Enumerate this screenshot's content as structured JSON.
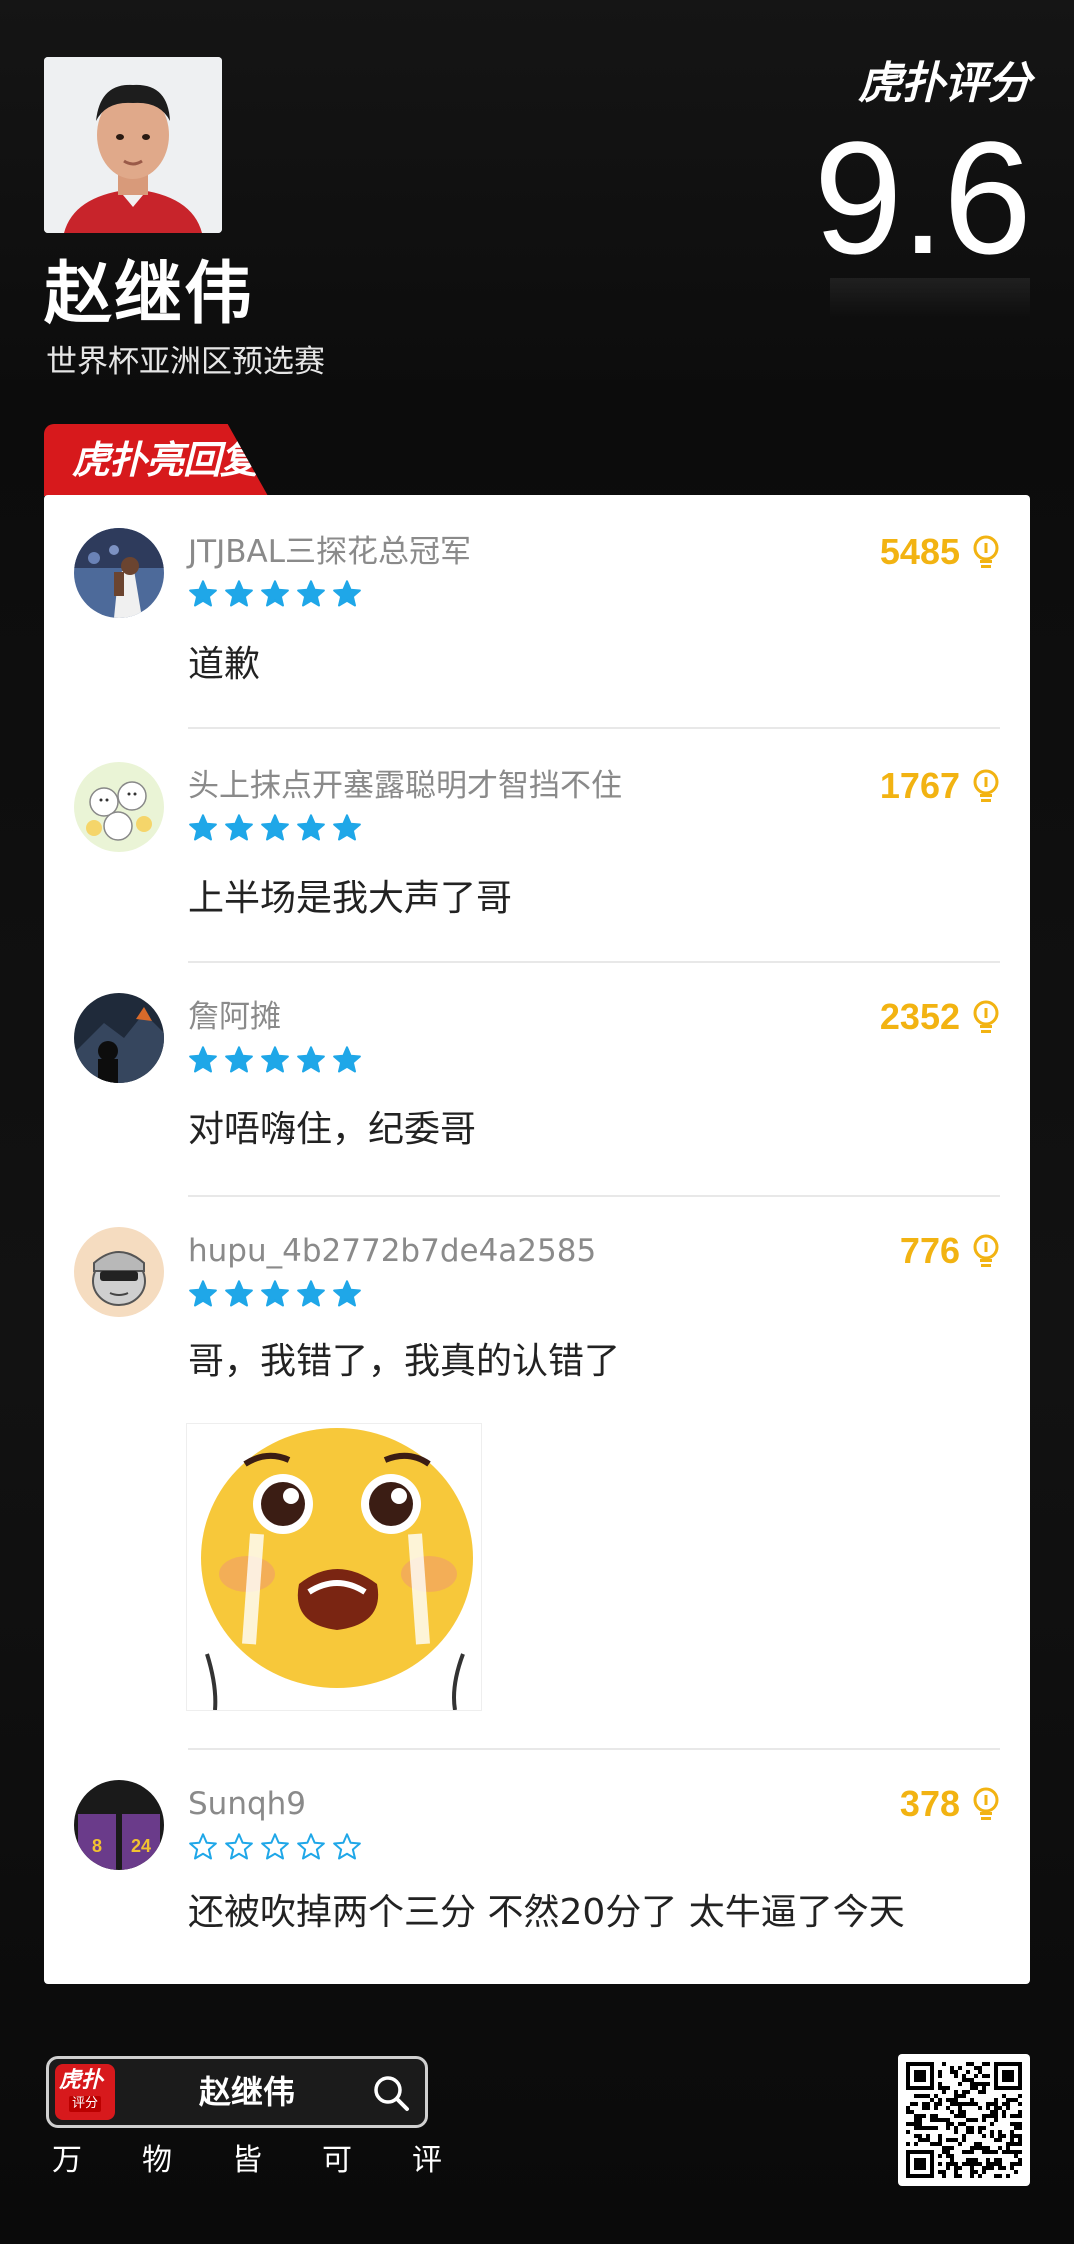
{
  "header": {
    "player_name": "赵继伟",
    "event_name": "世界杯亚洲区预选赛",
    "brand": "虎扑评分",
    "score": "9.6"
  },
  "hot_tag": {
    "label": "虎扑亮回复"
  },
  "comments": [
    {
      "username": "JTJBAL三探花总冠军",
      "likes": "5485",
      "stars": 5,
      "text": "道歉"
    },
    {
      "username": "头上抹点开塞露聪明才智挡不住",
      "likes": "1767",
      "stars": 5,
      "text": "上半场是我大声了哥"
    },
    {
      "username": "詹阿摊",
      "likes": "2352",
      "stars": 5,
      "text": "对唔嗨住，纪委哥"
    },
    {
      "username": "hupu_4b2772b7de4a2585",
      "likes": "776",
      "stars": 5,
      "text": "哥，我错了，我真的认错了"
    },
    {
      "username": "Sunqh9",
      "likes": "378",
      "stars": 0,
      "text": "还被吹掉两个三分  不然20分了  太牛逼了今天"
    }
  ],
  "footer": {
    "logo_text": "虎扑",
    "logo_sub": "评分",
    "search_text": "赵继伟",
    "slogan": [
      "万",
      "物",
      "皆",
      "可",
      "评"
    ]
  },
  "colors": {
    "accent_red": "#d7191c",
    "likes_gold": "#f2b312",
    "star_blue": "#1fa7e8"
  }
}
